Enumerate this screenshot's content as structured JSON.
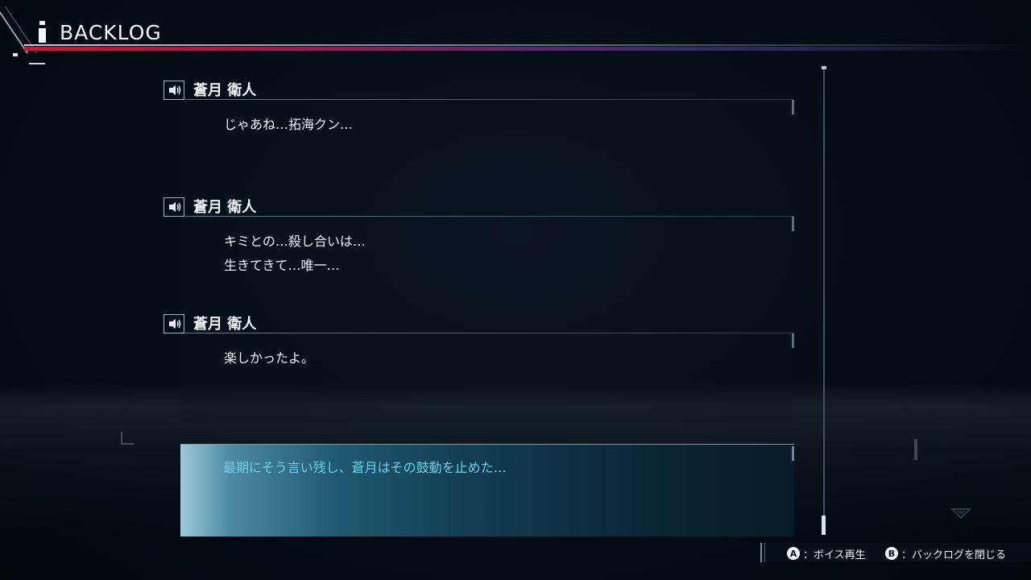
{
  "header": {
    "title": "BACKLOG"
  },
  "log": {
    "entries": [
      {
        "speaker": "蒼月 衛人",
        "text": "じゃあね…拓海クン…"
      },
      {
        "speaker": "蒼月 衛人",
        "text": "キミとの…殺し合いは…\n生きてきて…唯一…"
      },
      {
        "speaker": "蒼月 衛人",
        "text": "楽しかったよ。"
      }
    ],
    "narration": "最期にそう言い残し、蒼月はその鼓動を止めた…"
  },
  "scrollbar": {
    "position_fraction": 1.0
  },
  "footer": {
    "voice_button_glyph": "A",
    "voice_label": "：ボイス再生",
    "close_button_glyph": "B",
    "close_label": "：バックログを閉じる"
  },
  "colors": {
    "narration_text": "#66d4e6",
    "header_red": "#c01c34",
    "background": "#030b12"
  }
}
